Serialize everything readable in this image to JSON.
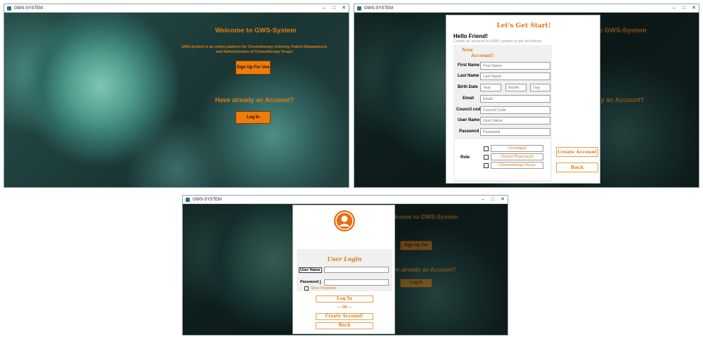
{
  "window_title": "GWS-SYSTEM",
  "welcome": {
    "title": "Welcome to GWS-System",
    "description_line1": "GWS-System is an online platform for Chemotherapy ordering, Patient Management,",
    "description_line2": "and Administration of Chemotherapy Drugs!",
    "signup_button": "Sign Up For Use",
    "have_account": "Have already an Account?",
    "login_button": "Log In"
  },
  "signup": {
    "header": "Let's Get Start!",
    "hello": "Hello Friend!",
    "sub": "Create an account to GWS system to get all feature",
    "new_account_line1": "New",
    "new_account_line2": "Account!",
    "fields": [
      {
        "label": "First Name",
        "placeholder": "First Name"
      },
      {
        "label": "Last Name",
        "placeholder": "Last Name"
      },
      {
        "label": "Email",
        "placeholder": "Email"
      },
      {
        "label": "Council code",
        "placeholder": "Council Code"
      },
      {
        "label": "User Name",
        "placeholder": "User Name"
      },
      {
        "label": "Password",
        "placeholder": "Password"
      }
    ],
    "birth": {
      "label": "Birth Date",
      "year": "Year",
      "month": "Month",
      "day": "Day"
    },
    "role_label": "Role",
    "roles": [
      "Oncologist",
      "Clinical Pharmacist",
      "Chemotherapy Nurse"
    ],
    "create_button": "Create Account",
    "back_button": "Back"
  },
  "login": {
    "title": "User Login",
    "username_label": "User Name",
    "password_label": "Password",
    "show_password": "Show Password",
    "login_button": "Log In",
    "or": "--- OR ---",
    "create_button": "Create Account!",
    "back_button": "Back"
  },
  "colors": {
    "accent": "#ef7d0a",
    "accent_text": "#e07a10"
  }
}
